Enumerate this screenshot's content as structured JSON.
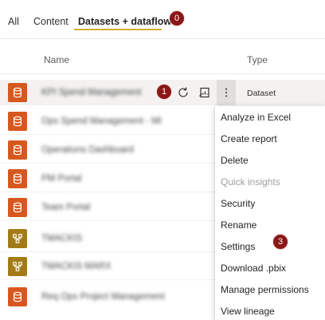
{
  "tabs": [
    {
      "label": "All"
    },
    {
      "label": "Content"
    },
    {
      "label": "Datasets + dataflows"
    }
  ],
  "badges": {
    "tab": "0",
    "row": "1",
    "menu": "3"
  },
  "table": {
    "headers": {
      "name": "Name",
      "type": "Type"
    },
    "rows": [
      {
        "kind": "dataset",
        "name": "KPI Spend Management",
        "type": "Dataset",
        "selected": true
      },
      {
        "kind": "dataset",
        "name": "Ops Spend Management - MI"
      },
      {
        "kind": "dataset",
        "name": "Operations Dashboard"
      },
      {
        "kind": "dataset",
        "name": "PM Portal"
      },
      {
        "kind": "dataset",
        "name": "Team Portal"
      },
      {
        "kind": "dataflow",
        "name": "TMACKIS"
      },
      {
        "kind": "dataflow",
        "name": "TMACKIS MARX"
      },
      {
        "kind": "dataset",
        "name": "Req Ops Project Management"
      }
    ]
  },
  "context_menu": {
    "items": [
      {
        "label": "Analyze in Excel",
        "enabled": true
      },
      {
        "label": "Create report",
        "enabled": true
      },
      {
        "label": "Delete",
        "enabled": true
      },
      {
        "label": "Quick insights",
        "enabled": false
      },
      {
        "label": "Security",
        "enabled": true
      },
      {
        "label": "Rename",
        "enabled": true
      },
      {
        "label": "Settings",
        "enabled": true
      },
      {
        "label": "Download .pbix",
        "enabled": true
      },
      {
        "label": "Manage permissions",
        "enabled": true
      },
      {
        "label": "View lineage",
        "enabled": true
      }
    ]
  },
  "icons": {
    "dataset_tile": "database-icon",
    "dataflow_tile": "dataflow-icon",
    "refresh": "refresh-icon",
    "create_report": "create-report-icon",
    "more": "more-options-icon"
  },
  "colors": {
    "dataset_tile": "#d6581e",
    "dataflow_tile": "#a37b16",
    "tab_underline": "#d3ad30",
    "badge": "#8b1717"
  }
}
